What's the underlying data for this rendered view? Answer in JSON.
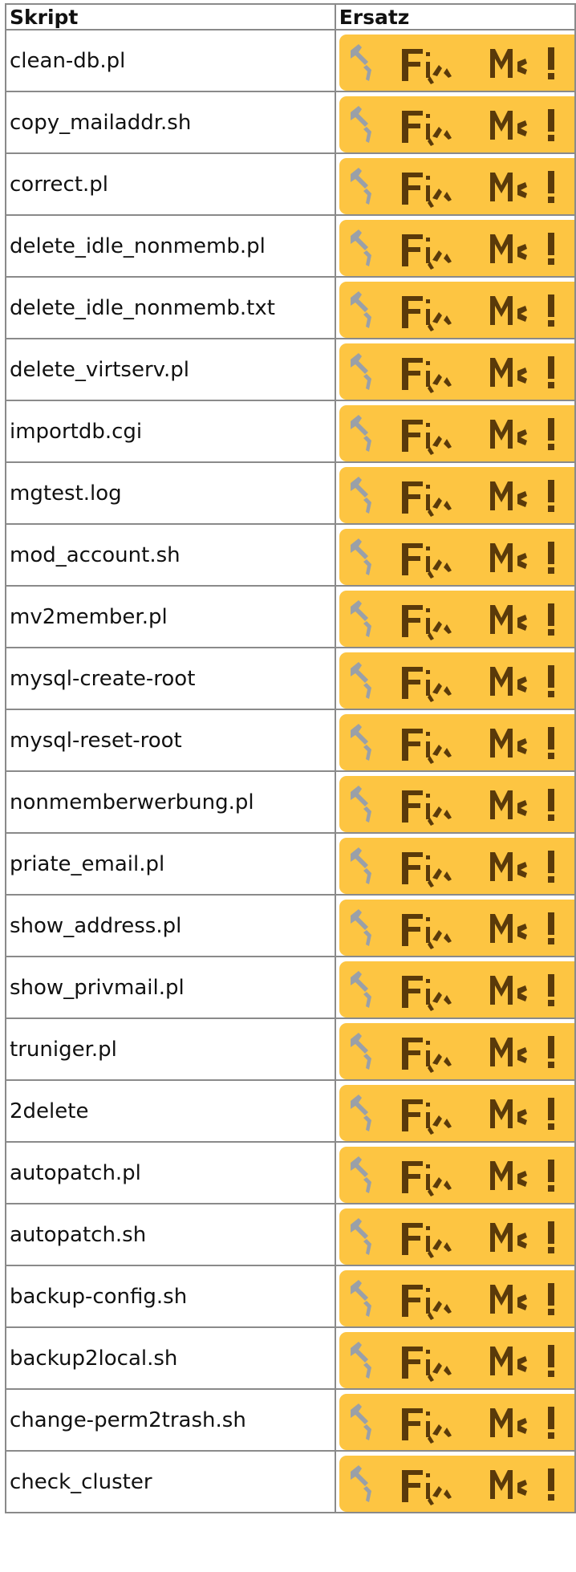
{
  "table": {
    "headers": {
      "script": "Skript",
      "replacement": "Ersatz"
    },
    "rows": [
      "clean-db.pl",
      "copy_mailaddr.sh",
      "correct.pl",
      "delete_idle_nonmemb.pl",
      "delete_idle_nonmemb.txt",
      "delete_virtserv.pl",
      "importdb.cgi",
      "mgtest.log",
      "mod_account.sh",
      "mv2member.pl",
      "mysql-create-root",
      "mysql-reset-root",
      "nonmemberwerbung.pl",
      "priate_email.pl",
      "show_address.pl",
      "show_privmail.pl",
      "truniger.pl",
      "2delete",
      "autopatch.pl",
      "autopatch.sh",
      "backup-config.sh",
      "backup2local.sh",
      "change-perm2trash.sh",
      "check_cluster"
    ]
  },
  "badge": {
    "icon": "fix-me-icon",
    "text": "FixMe!"
  },
  "colors": {
    "badge_bg": "#fdc542",
    "border": "#8a8a8a",
    "wrench": "#9aa0a8",
    "letters": "#5a3a0a"
  }
}
